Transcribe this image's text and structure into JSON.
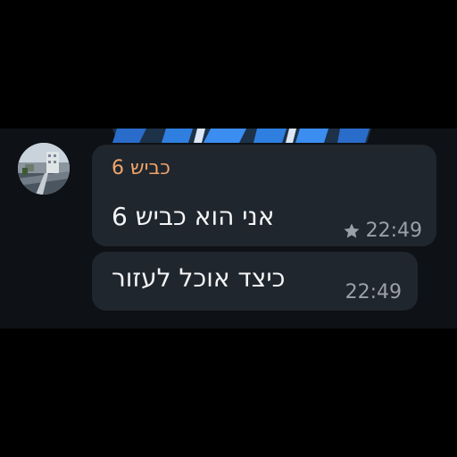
{
  "messages": [
    {
      "sender": "כביש 6",
      "text": "אני הוא כביש 6",
      "time": "22:49",
      "starred": true
    },
    {
      "text": "כיצד אוכל לעזור",
      "time": "22:49",
      "starred": false
    }
  ],
  "colors": {
    "sender_name": "#f0a46c",
    "bubble": "#20262d",
    "background": "#0e1115",
    "timestamp": "#9aa0a7"
  },
  "icons": {
    "star": "star-icon",
    "avatar": "avatar"
  }
}
